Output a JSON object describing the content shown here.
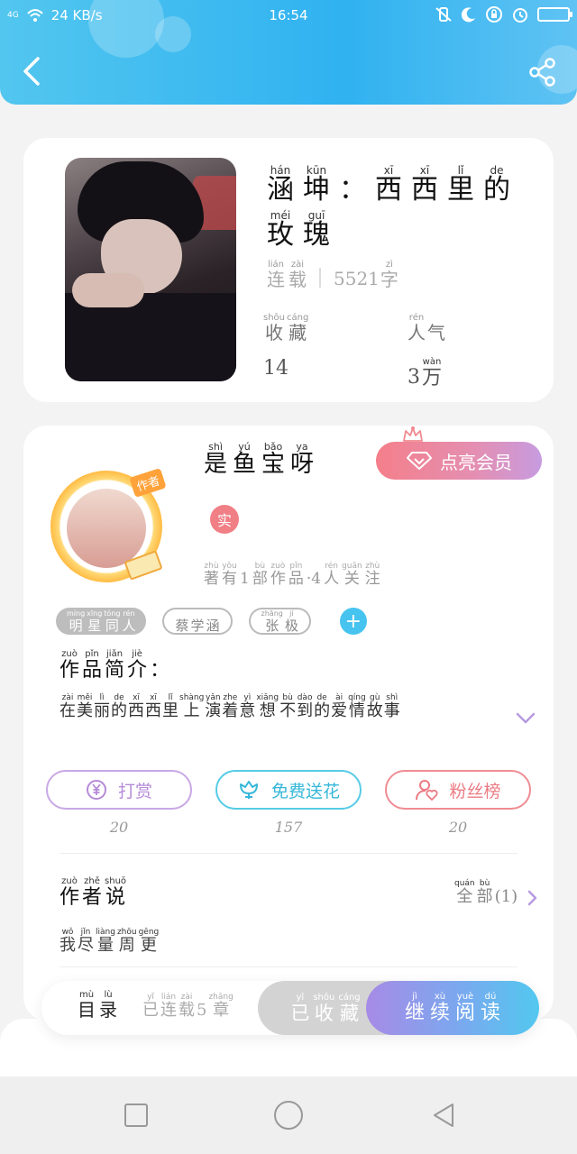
{
  "status_bar": {
    "signal": "4G",
    "speed": "24 KB/s",
    "time": "16:54"
  },
  "header": {
    "back_icon": "chevron-left-icon",
    "share_icon": "share-icon"
  },
  "book": {
    "title_line1": [
      {
        "py": "hán",
        "hz": "涵"
      },
      {
        "py": "kūn",
        "hz": "坤"
      },
      {
        "py": "",
        "hz": "："
      },
      {
        "py": "xī",
        "hz": "西"
      },
      {
        "py": "xī",
        "hz": "西"
      },
      {
        "py": "lǐ",
        "hz": "里"
      },
      {
        "py": "de",
        "hz": "的"
      }
    ],
    "title_line2": [
      {
        "py": "méi",
        "hz": "玫"
      },
      {
        "py": "guī",
        "hz": "瑰"
      }
    ],
    "status": [
      {
        "py": "lián",
        "hz": "连"
      },
      {
        "py": "zài",
        "hz": "载"
      }
    ],
    "word_count_num": "5521",
    "word_count_unit": {
      "py": "zì",
      "hz": "字"
    },
    "favorites_label": [
      {
        "py": "shōu",
        "hz": "收"
      },
      {
        "py": "cáng",
        "hz": "藏"
      }
    ],
    "favorites_value": "14",
    "popularity_label": [
      {
        "py": "rén",
        "hz": "人"
      },
      {
        "py": "",
        "hz": "气"
      }
    ],
    "popularity_num": "3",
    "popularity_unit": {
      "py": "wàn",
      "hz": "万"
    }
  },
  "author": {
    "name": [
      {
        "py": "shì",
        "hz": "是"
      },
      {
        "py": "yú",
        "hz": "鱼"
      },
      {
        "py": "bǎo",
        "hz": "宝"
      },
      {
        "py": "ya",
        "hz": "呀"
      }
    ],
    "avatar_tag": "作者",
    "vip_button": "点亮会员",
    "real_badge": "实",
    "meta": [
      {
        "py": "zhù",
        "hz": "著"
      },
      {
        "py": "yǒu",
        "hz": "有"
      },
      {
        "py": "",
        "hz": "1"
      },
      {
        "py": "bù",
        "hz": "部"
      },
      {
        "py": "zuò",
        "hz": "作"
      },
      {
        "py": "pǐn",
        "hz": "品"
      },
      {
        "py": "",
        "hz": "·4"
      },
      {
        "py": "rén",
        "hz": "人"
      },
      {
        "py": "guān",
        "hz": "关"
      },
      {
        "py": "zhù",
        "hz": "注"
      }
    ]
  },
  "tags": [
    {
      "style": "filled",
      "chars": [
        {
          "py": "míng",
          "hz": "明"
        },
        {
          "py": "xīng",
          "hz": "星"
        },
        {
          "py": "tóng",
          "hz": "同"
        },
        {
          "py": "rén",
          "hz": "人"
        }
      ]
    },
    {
      "style": "outline",
      "chars": [
        {
          "py": "",
          "hz": "蔡"
        },
        {
          "py": "",
          "hz": "学"
        },
        {
          "py": "",
          "hz": "涵"
        }
      ]
    },
    {
      "style": "outline",
      "chars": [
        {
          "py": "zhāng",
          "hz": "张"
        },
        {
          "py": "jí",
          "hz": "极"
        }
      ]
    }
  ],
  "intro": {
    "title": [
      {
        "py": "zuò",
        "hz": "作"
      },
      {
        "py": "pǐn",
        "hz": "品"
      },
      {
        "py": "jiǎn",
        "hz": "简"
      },
      {
        "py": "jiè",
        "hz": "介"
      },
      {
        "py": "",
        "hz": "："
      }
    ],
    "text": [
      {
        "py": "zài",
        "hz": "在"
      },
      {
        "py": "měi",
        "hz": "美"
      },
      {
        "py": "lì",
        "hz": "丽"
      },
      {
        "py": "de",
        "hz": "的"
      },
      {
        "py": "xī",
        "hz": "西"
      },
      {
        "py": "xī",
        "hz": "西"
      },
      {
        "py": "lǐ",
        "hz": "里"
      },
      {
        "py": "shàng",
        "hz": "上"
      },
      {
        "py": "yǎn",
        "hz": "演"
      },
      {
        "py": "zhe",
        "hz": "着"
      },
      {
        "py": "yì",
        "hz": "意"
      },
      {
        "py": "xiǎng",
        "hz": "想"
      },
      {
        "py": "bù",
        "hz": "不"
      },
      {
        "py": "dào",
        "hz": "到"
      },
      {
        "py": "de",
        "hz": "的"
      },
      {
        "py": "ài",
        "hz": "爱"
      },
      {
        "py": "qíng",
        "hz": "情"
      },
      {
        "py": "gù",
        "hz": "故"
      },
      {
        "py": "shì",
        "hz": "事"
      }
    ]
  },
  "actions": {
    "tip_label": "打赏",
    "tip_count": "20",
    "flower_label": "免费送花",
    "flower_count": "157",
    "fans_label": "粉丝榜",
    "fans_count": "20"
  },
  "author_says": {
    "title": [
      {
        "py": "zuò",
        "hz": "作"
      },
      {
        "py": "zhě",
        "hz": "者"
      },
      {
        "py": "shuō",
        "hz": "说"
      }
    ],
    "all": [
      {
        "py": "quán",
        "hz": "全"
      },
      {
        "py": "bù",
        "hz": "部"
      }
    ],
    "all_count": "(1)",
    "text": [
      {
        "py": "wǒ",
        "hz": "我"
      },
      {
        "py": "jǐn",
        "hz": "尽"
      },
      {
        "py": "liàng",
        "hz": "量"
      },
      {
        "py": "zhōu",
        "hz": "周"
      },
      {
        "py": "gēng",
        "hz": "更"
      }
    ]
  },
  "bottom_bar": {
    "toc": [
      {
        "py": "mù",
        "hz": "目"
      },
      {
        "py": "lù",
        "hz": "录"
      }
    ],
    "toc_sub": [
      {
        "py": "yǐ",
        "hz": "已"
      },
      {
        "py": "lián",
        "hz": "连"
      },
      {
        "py": "zài",
        "hz": "载"
      },
      {
        "py": "",
        "hz": "5"
      },
      {
        "py": "zhāng",
        "hz": "章"
      }
    ],
    "collected": [
      {
        "py": "yǐ",
        "hz": "已"
      },
      {
        "py": "shōu",
        "hz": "收"
      },
      {
        "py": "cáng",
        "hz": "藏"
      }
    ],
    "read": [
      {
        "py": "jì",
        "hz": "继"
      },
      {
        "py": "xù",
        "hz": "续"
      },
      {
        "py": "yuè",
        "hz": "阅"
      },
      {
        "py": "dú",
        "hz": "读"
      }
    ]
  },
  "colors": {
    "header_start": "#52c6ef",
    "header_end": "#5fc3f3",
    "vip_start": "#f47f8a",
    "vip_end": "#c79be0",
    "read_start": "#a78be6",
    "read_end": "#52c8ef"
  }
}
